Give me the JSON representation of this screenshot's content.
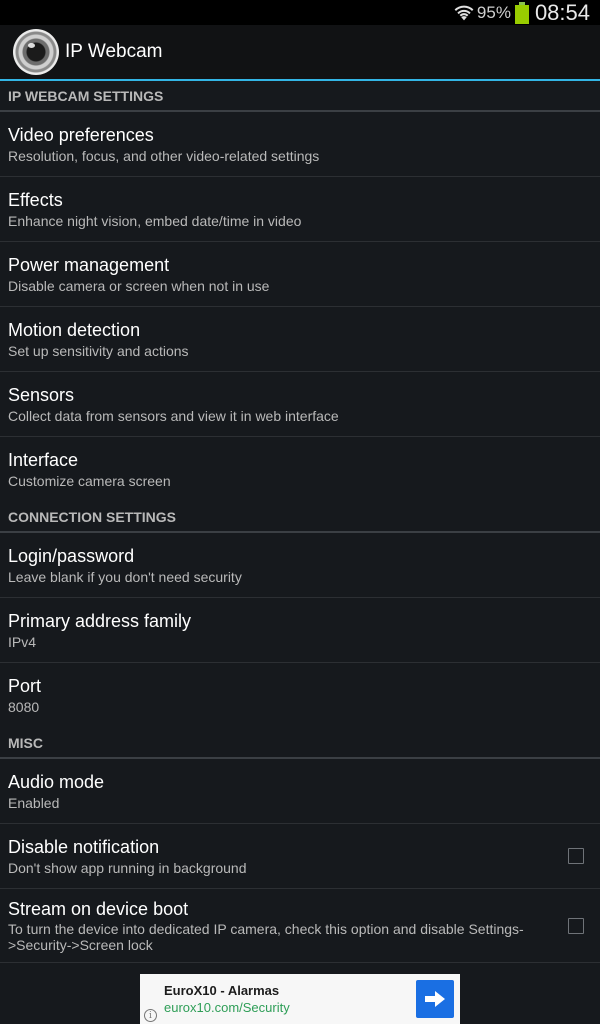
{
  "status_bar": {
    "battery": "95%",
    "time": "08:54"
  },
  "app": {
    "title": "IP Webcam"
  },
  "sections": {
    "settings": {
      "header": "IP WEBCAM SETTINGS",
      "items": [
        {
          "title": "Video preferences",
          "summary": "Resolution, focus, and other video-related settings"
        },
        {
          "title": "Effects",
          "summary": "Enhance night vision, embed date/time in video"
        },
        {
          "title": "Power management",
          "summary": "Disable camera or screen when not in use"
        },
        {
          "title": "Motion detection",
          "summary": "Set up sensitivity and actions"
        },
        {
          "title": "Sensors",
          "summary": "Collect data from sensors and view it in web interface"
        },
        {
          "title": "Interface",
          "summary": "Customize camera screen"
        }
      ]
    },
    "connection": {
      "header": "CONNECTION SETTINGS",
      "items": [
        {
          "title": "Login/password",
          "summary": "Leave blank if you don't need security"
        },
        {
          "title": "Primary address family",
          "summary": "IPv4"
        },
        {
          "title": "Port",
          "summary": "8080"
        }
      ]
    },
    "misc": {
      "header": "MISC",
      "items": [
        {
          "title": "Audio mode",
          "summary": "Enabled"
        },
        {
          "title": "Disable notification",
          "summary": "Don't show app running in background",
          "checked": false
        },
        {
          "title": "Stream on device boot",
          "summary": "To turn the device into dedicated IP camera, check this option and disable Settings->Security->Screen lock",
          "checked": false
        }
      ]
    }
  },
  "ad": {
    "title": "EuroX10 - Alarmas",
    "url": "eurox10.com/Security"
  },
  "colors": {
    "accent": "#33b5e5",
    "battery": "#99cc00",
    "ad_button": "#1a6fe3",
    "ad_url": "#2e9e57"
  }
}
